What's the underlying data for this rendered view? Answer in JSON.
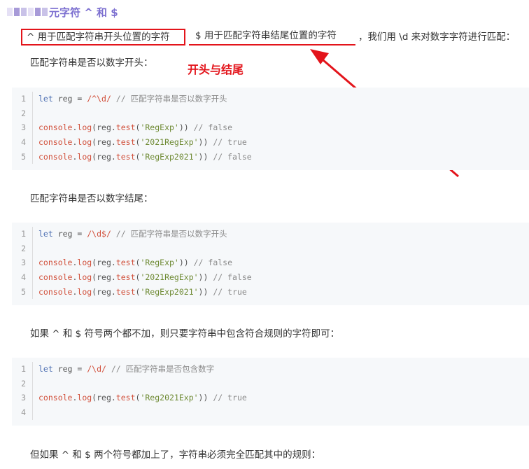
{
  "heading": {
    "text": "元字符 ^ 和 $"
  },
  "intro": {
    "caret_text": "^ 用于匹配字符串开头位置的字符",
    "dollar_text": "$ 用于匹配字符串结尾位置的字符",
    "rest_text": "，我们用 \\d 来对数字字符进行匹配："
  },
  "annotation": {
    "text": "开头与结尾"
  },
  "sections": [
    {
      "label": "匹配字符串是否以数字开头：",
      "lines": [
        {
          "num": "1",
          "tokens": [
            [
              "kw",
              "let"
            ],
            [
              "plain",
              " reg = "
            ],
            [
              "re",
              "/^\\d/"
            ],
            [
              "cm",
              " // 匹配字符串是否以数字开头"
            ]
          ]
        },
        {
          "num": "2",
          "tokens": []
        },
        {
          "num": "3",
          "tokens": [
            [
              "fn",
              "console"
            ],
            [
              "plain",
              "."
            ],
            [
              "fn",
              "log"
            ],
            [
              "plain",
              "(reg."
            ],
            [
              "fn",
              "test"
            ],
            [
              "plain",
              "("
            ],
            [
              "str",
              "'RegExp'"
            ],
            [
              "plain",
              "))"
            ],
            [
              "cm",
              " // false"
            ]
          ]
        },
        {
          "num": "4",
          "tokens": [
            [
              "fn",
              "console"
            ],
            [
              "plain",
              "."
            ],
            [
              "fn",
              "log"
            ],
            [
              "plain",
              "(reg."
            ],
            [
              "fn",
              "test"
            ],
            [
              "plain",
              "("
            ],
            [
              "str",
              "'2021RegExp'"
            ],
            [
              "plain",
              "))"
            ],
            [
              "cm",
              " // true"
            ]
          ]
        },
        {
          "num": "5",
          "tokens": [
            [
              "fn",
              "console"
            ],
            [
              "plain",
              "."
            ],
            [
              "fn",
              "log"
            ],
            [
              "plain",
              "(reg."
            ],
            [
              "fn",
              "test"
            ],
            [
              "plain",
              "("
            ],
            [
              "str",
              "'RegExp2021'"
            ],
            [
              "plain",
              "))"
            ],
            [
              "cm",
              " // false"
            ]
          ]
        }
      ]
    },
    {
      "label": "匹配字符串是否以数字结尾：",
      "lines": [
        {
          "num": "1",
          "tokens": [
            [
              "kw",
              "let"
            ],
            [
              "plain",
              " reg = "
            ],
            [
              "re",
              "/\\d$/"
            ],
            [
              "cm",
              " // 匹配字符串是否以数字开头"
            ]
          ]
        },
        {
          "num": "2",
          "tokens": []
        },
        {
          "num": "3",
          "tokens": [
            [
              "fn",
              "console"
            ],
            [
              "plain",
              "."
            ],
            [
              "fn",
              "log"
            ],
            [
              "plain",
              "(reg."
            ],
            [
              "fn",
              "test"
            ],
            [
              "plain",
              "("
            ],
            [
              "str",
              "'RegExp'"
            ],
            [
              "plain",
              "))"
            ],
            [
              "cm",
              " // false"
            ]
          ]
        },
        {
          "num": "4",
          "tokens": [
            [
              "fn",
              "console"
            ],
            [
              "plain",
              "."
            ],
            [
              "fn",
              "log"
            ],
            [
              "plain",
              "(reg."
            ],
            [
              "fn",
              "test"
            ],
            [
              "plain",
              "("
            ],
            [
              "str",
              "'2021RegExp'"
            ],
            [
              "plain",
              "))"
            ],
            [
              "cm",
              " // false"
            ]
          ]
        },
        {
          "num": "5",
          "tokens": [
            [
              "fn",
              "console"
            ],
            [
              "plain",
              "."
            ],
            [
              "fn",
              "log"
            ],
            [
              "plain",
              "(reg."
            ],
            [
              "fn",
              "test"
            ],
            [
              "plain",
              "("
            ],
            [
              "str",
              "'RegExp2021'"
            ],
            [
              "plain",
              "))"
            ],
            [
              "cm",
              " // true"
            ]
          ]
        }
      ]
    },
    {
      "label": "如果 ^ 和 $ 符号两个都不加，则只要字符串中包含符合规则的字符即可：",
      "lines": [
        {
          "num": "1",
          "tokens": [
            [
              "kw",
              "let"
            ],
            [
              "plain",
              " reg = "
            ],
            [
              "re",
              "/\\d/"
            ],
            [
              "cm",
              " // 匹配字符串是否包含数字"
            ]
          ]
        },
        {
          "num": "2",
          "tokens": []
        },
        {
          "num": "3",
          "tokens": [
            [
              "fn",
              "console"
            ],
            [
              "plain",
              "."
            ],
            [
              "fn",
              "log"
            ],
            [
              "plain",
              "(reg."
            ],
            [
              "fn",
              "test"
            ],
            [
              "plain",
              "("
            ],
            [
              "str",
              "'Reg2021Exp'"
            ],
            [
              "plain",
              "))"
            ],
            [
              "cm",
              " // true"
            ]
          ]
        },
        {
          "num": "4",
          "tokens": []
        }
      ]
    }
  ],
  "closing": {
    "text": "但如果 ^ 和 $ 两个符号都加上了，字符串必须完全匹配其中的规则："
  },
  "colors": {
    "accent": "#7c6fd0",
    "annotation_red": "#e3141b",
    "code_bg": "#f6f8fa"
  }
}
